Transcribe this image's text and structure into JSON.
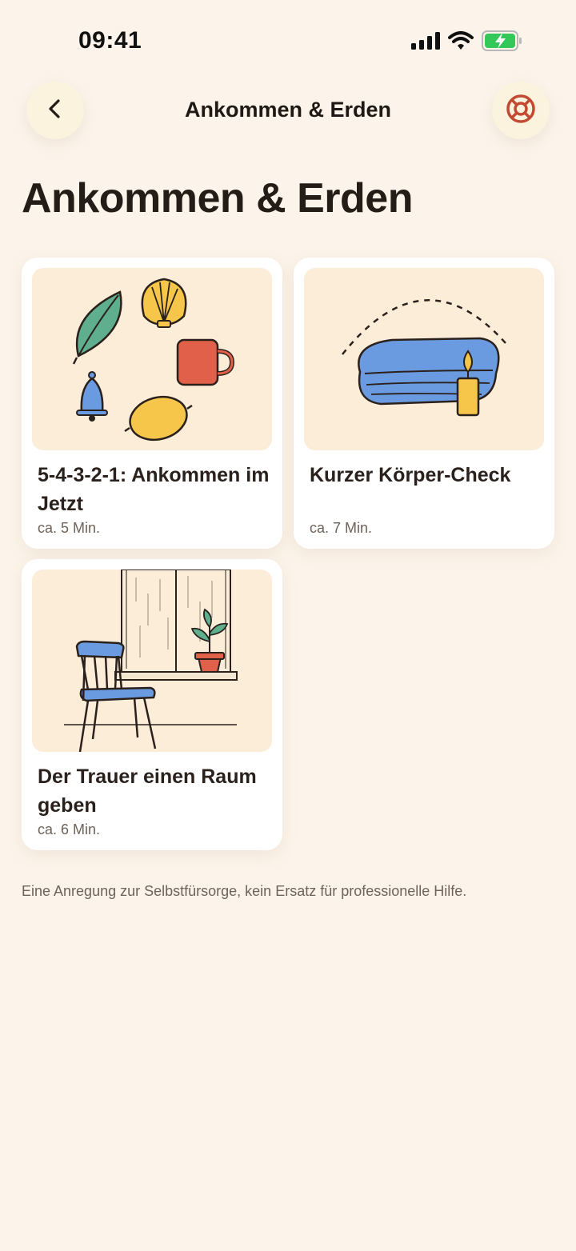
{
  "status_bar": {
    "time": "09:41",
    "icons": [
      "signal-icon",
      "wifi-icon",
      "battery-charging-icon"
    ],
    "battery_color": "#34C759"
  },
  "header": {
    "title": "Ankommen & Erden",
    "back_icon": "chevron-left-icon",
    "help_icon": "lifebuoy-icon"
  },
  "page_title": "Ankommen & Erden",
  "cards": [
    {
      "title": "5-4-3-2-1: Ankommen im Jetzt",
      "duration": "ca. 5 Min.",
      "image": "sensory-objects-illustration"
    },
    {
      "title": "Kurzer Körper-Check",
      "duration": "ca. 7 Min.",
      "image": "blanket-candle-illustration"
    },
    {
      "title": "Der Trauer einen Raum geben",
      "duration": "ca. 6 Min.",
      "image": "chair-window-plant-illustration"
    }
  ],
  "disclaimer": "Eine Anregung zur Selbstfürsorge, kein Ersatz für professionelle Hilfe.",
  "colors": {
    "background": "#FCF4EA",
    "card": "#FFFFFF",
    "image_bg": "#FCEDD8",
    "accent_red": "#E0604A",
    "accent_blue": "#6A9BE0",
    "accent_yellow": "#F5C64A",
    "accent_green": "#5FAF8E"
  }
}
